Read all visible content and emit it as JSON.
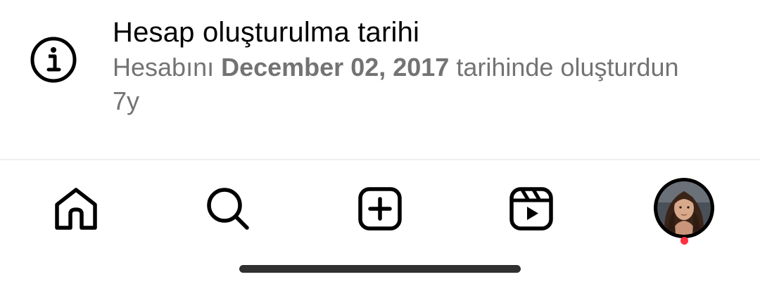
{
  "account_info": {
    "title": "Hesap oluşturulma tarihi",
    "description_prefix": "Hesabını ",
    "date": "December 02, 2017",
    "description_suffix": " tarihinde oluşturdun",
    "age": "7y",
    "icon": "info-circle-icon"
  },
  "bottom_nav": {
    "items": [
      {
        "name": "home",
        "icon": "home-icon"
      },
      {
        "name": "search",
        "icon": "search-icon"
      },
      {
        "name": "create",
        "icon": "plus-square-icon"
      },
      {
        "name": "reels",
        "icon": "reels-icon"
      },
      {
        "name": "profile",
        "icon": "avatar"
      }
    ],
    "notification_dot_color": "#ff3040"
  }
}
